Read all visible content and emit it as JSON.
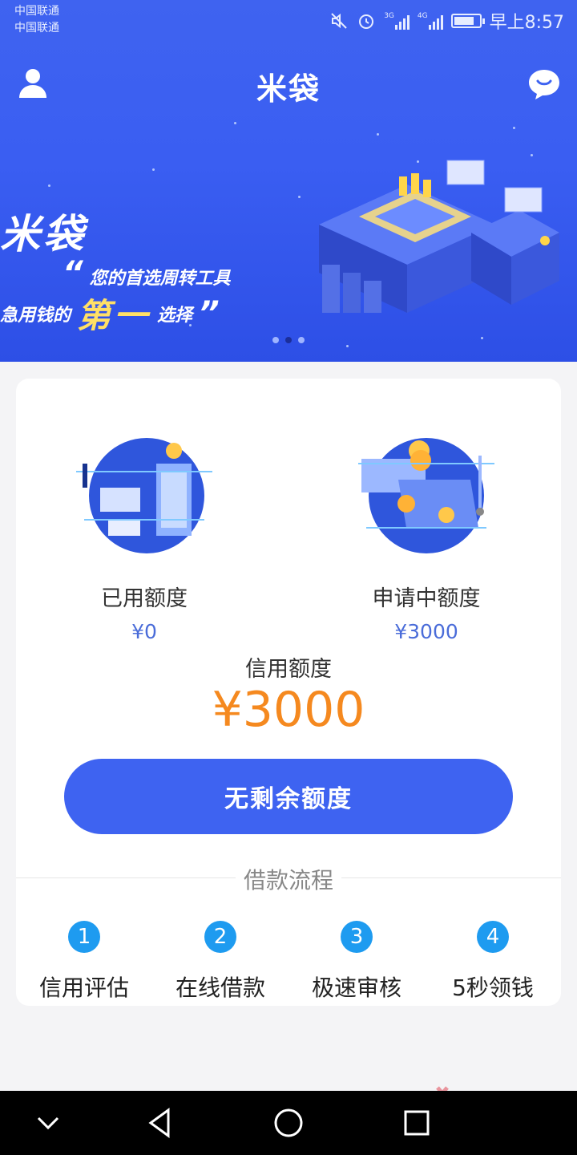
{
  "status_bar": {
    "carrier_1": "中国联通",
    "carrier_2": "中国联通",
    "network_1": "3G",
    "network_2": "4G",
    "time": "早上8:57"
  },
  "nav": {
    "title": "米袋"
  },
  "banner": {
    "logo_text": "米袋",
    "slogan_line1": "您的首选周转工具",
    "slogan_line2_prefix": "急用钱的",
    "slogan_highlight": "第一",
    "slogan_line2_suffix": "选择",
    "quote_open": "“",
    "quote_close": "”",
    "page_count": 3,
    "active_page": 2
  },
  "card": {
    "used": {
      "label": "已用额度",
      "value": "¥0"
    },
    "applying": {
      "label": "申请中额度",
      "value": "¥3000"
    },
    "credit": {
      "label": "信用额度",
      "value": "¥3000"
    },
    "button_label": "无剩余额度",
    "flow_title": "借款流程",
    "steps": [
      {
        "num": "1",
        "label": "信用评估"
      },
      {
        "num": "2",
        "label": "在线借款"
      },
      {
        "num": "3",
        "label": "极速审核"
      },
      {
        "num": "4",
        "label": "5秒领钱"
      }
    ]
  },
  "colors": {
    "brand_blue": "#3e63f1",
    "amount_orange": "#f5891f",
    "step_blue": "#1e9bf0",
    "value_blue": "#4a6cd9"
  }
}
